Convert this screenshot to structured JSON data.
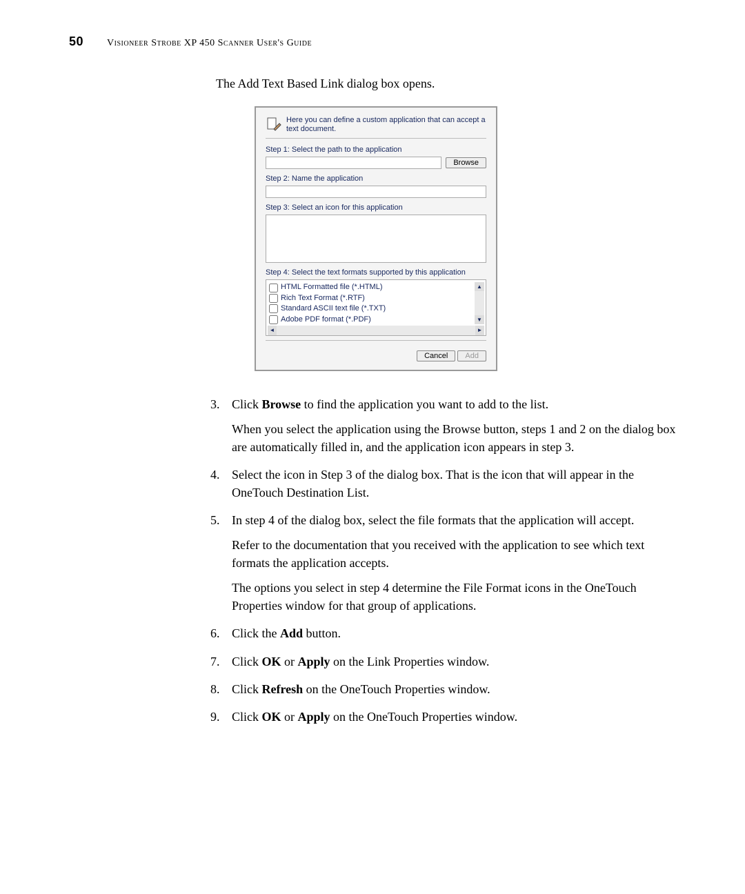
{
  "page_number": "50",
  "header_text": "Visioneer Strobe XP 450 Scanner User's Guide",
  "intro": "The Add Text Based Link dialog box opens.",
  "dialog": {
    "header": "Here you can define a custom application that can accept a text document.",
    "step1": "Step 1: Select the path to the application",
    "browse": "Browse",
    "step2": "Step 2: Name the application",
    "step3": "Step 3: Select an icon for this application",
    "step4": "Step 4: Select the text formats supported by this application",
    "formats": [
      "HTML Formatted file (*.HTML)",
      "Rich Text Format (*.RTF)",
      "Standard ASCII text file (*.TXT)",
      "Adobe PDF format (*.PDF)"
    ],
    "cancel": "Cancel",
    "add": "Add"
  },
  "steps": {
    "s3a": "Click ",
    "s3b": "Browse",
    "s3c": " to find the application you want to add to the list.",
    "s3p": "When you select the application using the Browse button, steps 1 and 2 on the dialog box are automatically filled in, and the application icon appears in step 3.",
    "s4": "Select the icon in Step 3 of the dialog box. That is the icon that will appear in the OneTouch Destination List.",
    "s5": "In step 4 of the dialog box, select the file formats that the application will accept.",
    "s5p1": "Refer to the documentation that you received with the application to see which text formats the application accepts.",
    "s5p2": "The options you select in step 4 determine the File Format icons in the OneTouch Properties window for that group of applications.",
    "s6a": "Click the ",
    "s6b": "Add",
    "s6c": " button.",
    "s7a": "Click ",
    "s7b": "OK",
    "s7c": " or ",
    "s7d": "Apply",
    "s7e": " on the Link Properties window.",
    "s8a": "Click ",
    "s8b": "Refresh",
    "s8c": " on the OneTouch Properties window.",
    "s9a": "Click ",
    "s9b": "OK",
    "s9c": " or ",
    "s9d": "Apply",
    "s9e": " on the OneTouch Properties window."
  }
}
